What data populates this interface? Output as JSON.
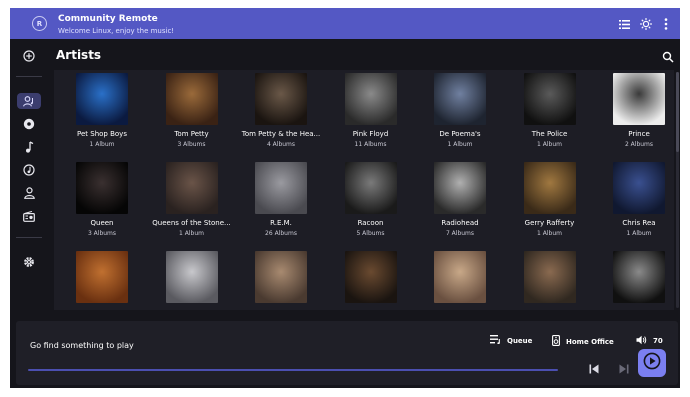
{
  "app": {
    "title": "Community Remote",
    "subtitle": "Welcome Linux, enjoy the music!"
  },
  "header": {
    "icons": [
      "list-icon",
      "brightness-icon",
      "more-vert-icon"
    ]
  },
  "sidebar": {
    "items": [
      {
        "icon": "add-circle-icon",
        "active": false
      },
      {
        "icon": "artist-icon",
        "active": true
      },
      {
        "icon": "album-icon",
        "active": false
      },
      {
        "icon": "music-note-icon",
        "active": false
      },
      {
        "icon": "genre-icon",
        "active": false
      },
      {
        "icon": "person-icon",
        "active": false
      },
      {
        "icon": "radio-icon",
        "active": false
      },
      {
        "icon": "settings-icon",
        "active": false
      }
    ]
  },
  "page": {
    "title": "Artists"
  },
  "artists": [
    {
      "name": "Pet Shop Boys",
      "count": "1 Album",
      "tone": [
        "#0b1a40",
        "#2a70c8"
      ]
    },
    {
      "name": "Tom Petty",
      "count": "3 Albums",
      "tone": [
        "#3a2214",
        "#9a6a3a"
      ]
    },
    {
      "name": "Tom Petty & the Hea...",
      "count": "4 Albums",
      "tone": [
        "#1a1410",
        "#6a5848"
      ]
    },
    {
      "name": "Pink Floyd",
      "count": "11 Albums",
      "tone": [
        "#2a2a2a",
        "#8a8a8a"
      ]
    },
    {
      "name": "De Poema's",
      "count": "1 Album",
      "tone": [
        "#1e2430",
        "#7080a0"
      ]
    },
    {
      "name": "The Police",
      "count": "1 Album",
      "tone": [
        "#101010",
        "#5a5a5a"
      ]
    },
    {
      "name": "Prince",
      "count": "2 Albums",
      "tone": [
        "#ececec",
        "#3a3a3a"
      ]
    },
    {
      "name": "Queen",
      "count": "3 Albums",
      "tone": [
        "#050505",
        "#3a3030"
      ]
    },
    {
      "name": "Queens of the Stone...",
      "count": "1 Album",
      "tone": [
        "#2a2220",
        "#6a5448"
      ]
    },
    {
      "name": "R.E.M.",
      "count": "26 Albums",
      "tone": [
        "#4a4a50",
        "#9a9aa0"
      ]
    },
    {
      "name": "Racoon",
      "count": "5 Albums",
      "tone": [
        "#1a1a1a",
        "#7a7a7a"
      ]
    },
    {
      "name": "Radiohead",
      "count": "7 Albums",
      "tone": [
        "#2a2a2a",
        "#b0b0b0"
      ]
    },
    {
      "name": "Gerry Rafferty",
      "count": "1 Album",
      "tone": [
        "#3a2a18",
        "#a07840"
      ]
    },
    {
      "name": "Chris Rea",
      "count": "1 Album",
      "tone": [
        "#101830",
        "#3a5090"
      ]
    },
    {
      "name": "",
      "count": "",
      "tone": [
        "#6a3010",
        "#c07030"
      ]
    },
    {
      "name": "",
      "count": "",
      "tone": [
        "#5a5a60",
        "#c8c8cc"
      ]
    },
    {
      "name": "",
      "count": "",
      "tone": [
        "#4a3a30",
        "#a88a70"
      ]
    },
    {
      "name": "",
      "count": "",
      "tone": [
        "#1a1410",
        "#6a4a30"
      ]
    },
    {
      "name": "",
      "count": "",
      "tone": [
        "#6a5040",
        "#c8a888"
      ]
    },
    {
      "name": "",
      "count": "",
      "tone": [
        "#302820",
        "#8a6a50"
      ]
    },
    {
      "name": "",
      "count": "",
      "tone": [
        "#101010",
        "#8a8a8a"
      ]
    }
  ],
  "player": {
    "now_playing": "Go find something to play",
    "queue_label": "Queue",
    "output_label": "Home Office",
    "volume": "70",
    "progress": 0
  },
  "colors": {
    "accent": "#5458c4",
    "play_button": "#7b7ff0",
    "background": "#15151b"
  }
}
